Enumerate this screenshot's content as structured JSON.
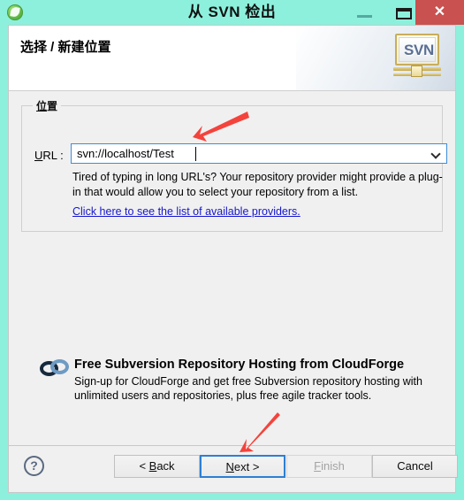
{
  "window": {
    "title": "从 SVN 检出",
    "app_icon": "spring-leaf-icon",
    "minimize_label": "—",
    "maximize_label": "❐",
    "close_label": "✕",
    "close_color": "#c9514f",
    "titlebar_color": "#8df0dc"
  },
  "header": {
    "title": "选择 / 新建位置",
    "logo_text": "SVN",
    "logo_name": "svn-repository-icon"
  },
  "location_group": {
    "legend_accel": "位",
    "legend_rest": "置",
    "url_label_accel": "U",
    "url_label_rest": "RL :",
    "url_value": "svn://localhost/Test",
    "url_placeholder": "svn://localhost/Test",
    "hint": "Tired of typing in long URL's?  Your repository provider might provide a plug-in that would allow you to select your repository from a list.",
    "provider_link": "Click here to see the list of available providers.",
    "link_color": "#1616d0",
    "focus_color": "#3c8ddc"
  },
  "promo": {
    "title": "Free Subversion Repository Hosting from CloudForge",
    "body": "Sign-up for CloudForge and get free Subversion repository hosting with unlimited users and repositories, plus free agile tracker tools.",
    "icon_name": "cloudforge-cloud-icon"
  },
  "footer": {
    "help_label": "?",
    "buttons": [
      {
        "accel": "B",
        "pre": "< ",
        "post": "ack",
        "name": "back-button",
        "enabled": true,
        "focused": false
      },
      {
        "accel": "N",
        "pre": "",
        "post": "ext >",
        "name": "next-button",
        "enabled": true,
        "focused": true
      },
      {
        "accel": "F",
        "pre": "",
        "post": "inish",
        "name": "finish-button",
        "enabled": false,
        "focused": false
      },
      {
        "accel": "",
        "pre": "Cancel",
        "post": "",
        "name": "cancel-button",
        "enabled": true,
        "focused": false
      }
    ]
  },
  "annotations": {
    "arrow_color": "#f4433c",
    "arrow_url_target": "url-combobox",
    "arrow_next_target": "next-button"
  }
}
